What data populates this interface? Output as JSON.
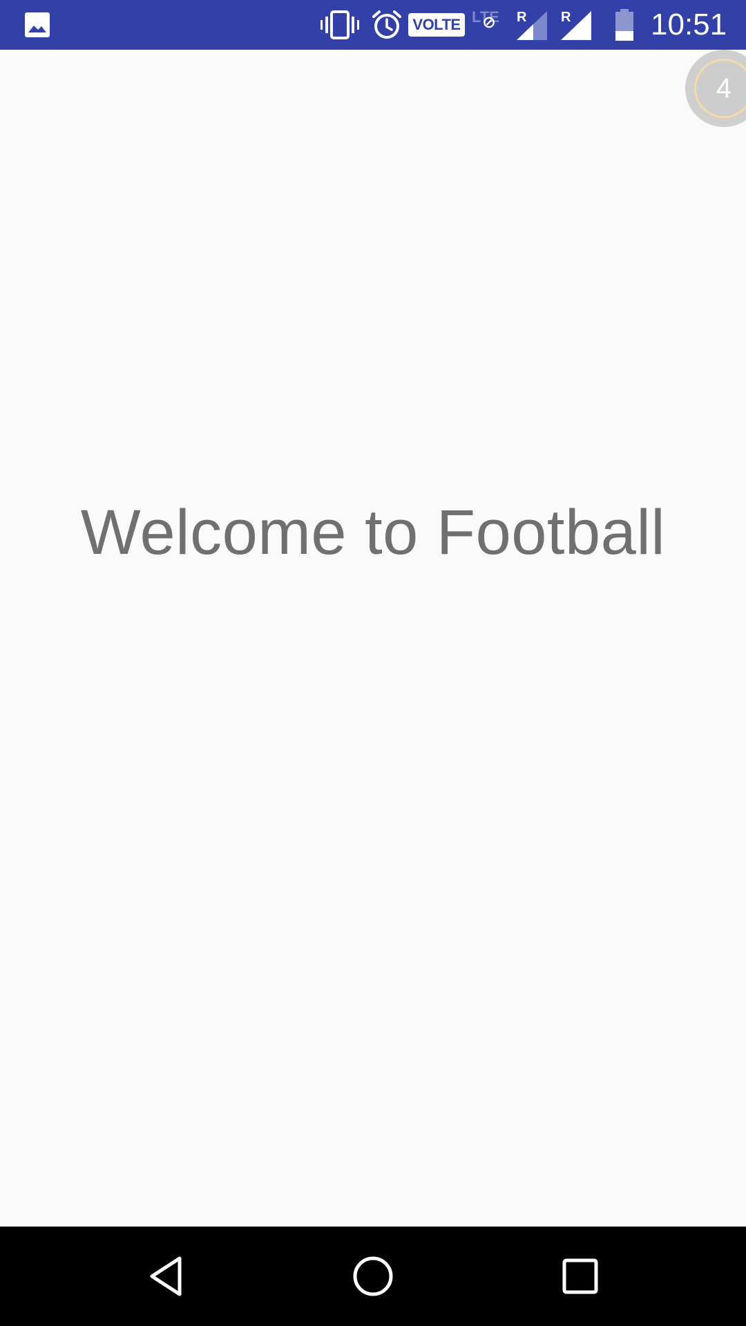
{
  "status_bar": {
    "time": "10:51",
    "volte_label": "VOLTE",
    "lte_label": "LTE",
    "roaming_1": "R",
    "roaming_2": "R",
    "icons": {
      "gallery": "image-icon",
      "vibrate": "vibrate-icon",
      "alarm": "alarm-icon",
      "battery": "battery-icon",
      "signal": "signal-icon"
    },
    "background_color": "#3240a8"
  },
  "main": {
    "welcome_text": "Welcome to Football",
    "text_color": "#707070",
    "background_color": "#fafafa"
  },
  "touch_counter": {
    "count": "4"
  },
  "nav_bar": {
    "icons": [
      "back-icon",
      "home-icon",
      "recent-apps-icon"
    ]
  }
}
